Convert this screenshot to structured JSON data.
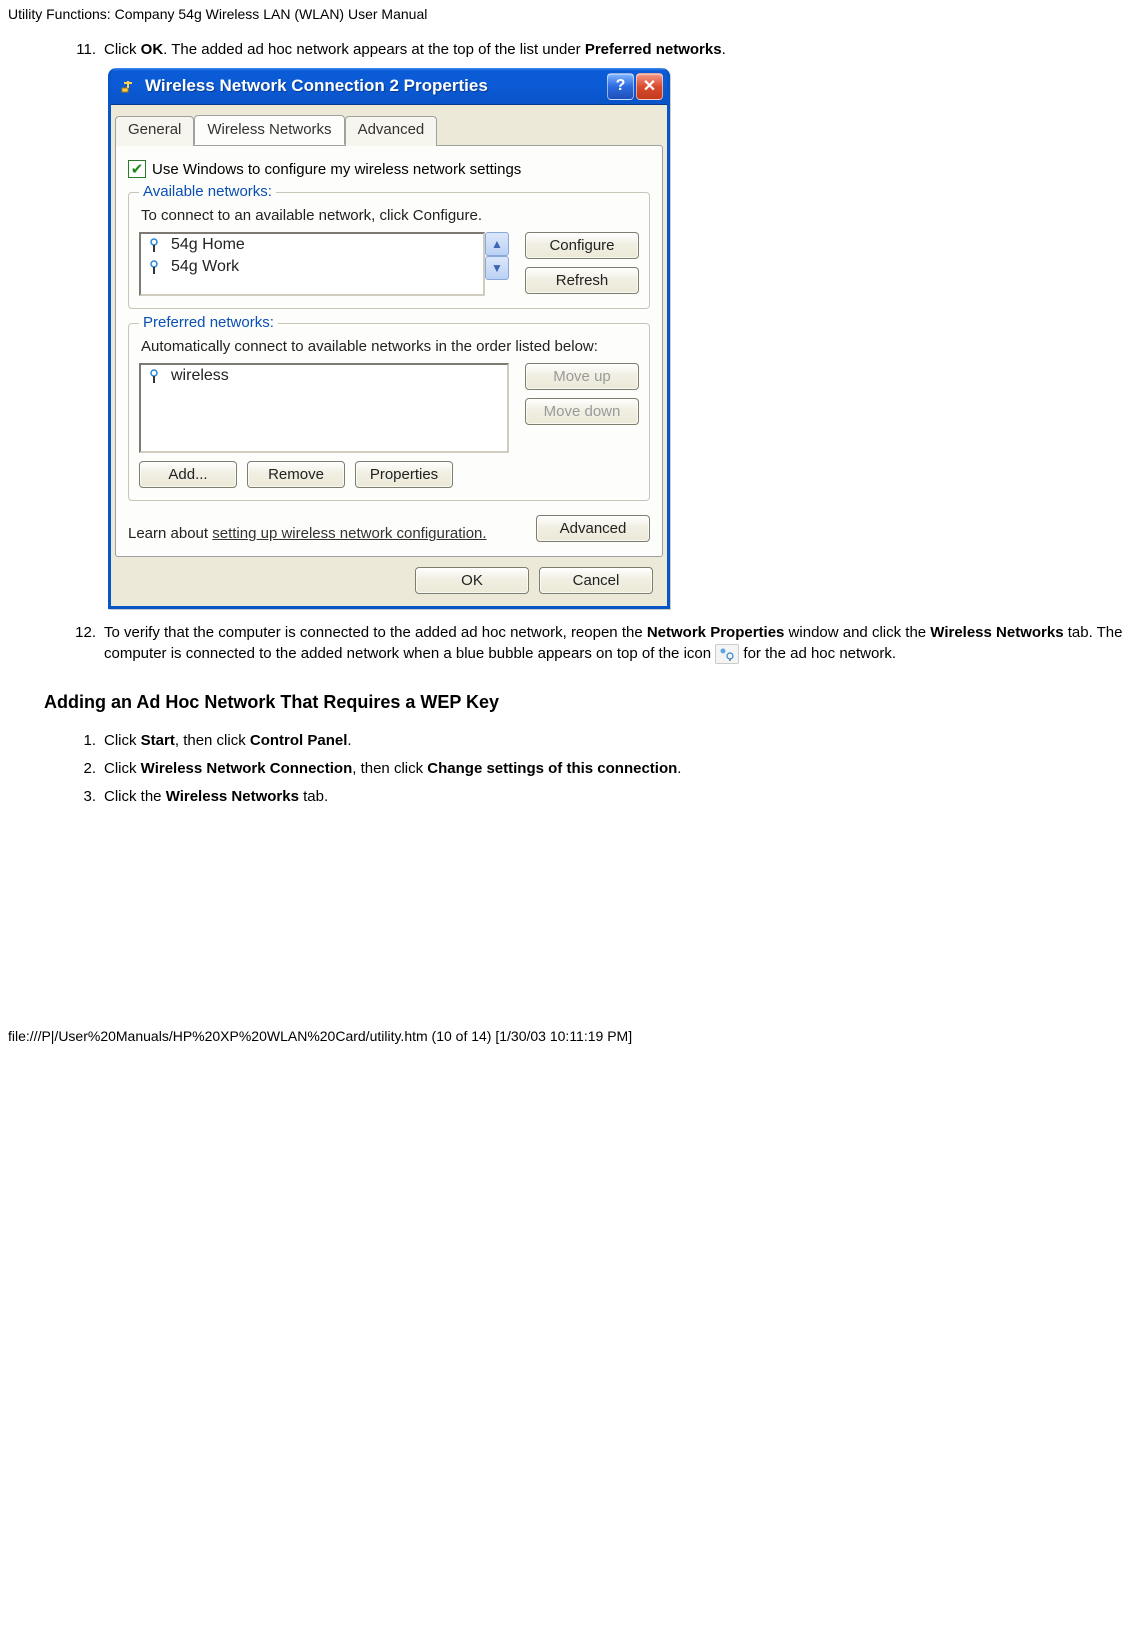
{
  "page_header": "Utility Functions: Company 54g Wireless LAN (WLAN) User Manual",
  "steps_a": {
    "11": {
      "pre": "Click ",
      "b1": "OK",
      "post1": ". The added ad hoc network appears at the top of the list under ",
      "b2": "Preferred networks",
      "post2": "."
    },
    "12": {
      "pre": "To verify that the computer is connected to the added ad hoc network, reopen the ",
      "b1": "Network Properties",
      "mid1": " window and click the ",
      "b2": "Wireless Networks",
      "mid2": " tab. The computer is connected to the added network when a blue bubble appears on top of the icon ",
      "post": " for the ad hoc network."
    }
  },
  "section_title": "Adding an Ad Hoc Network That Requires a WEP Key",
  "steps_b": {
    "1": {
      "pre": "Click ",
      "b1": "Start",
      "mid": ", then click ",
      "b2": "Control Panel",
      "post": "."
    },
    "2": {
      "pre": "Click ",
      "b1": "Wireless Network Connection",
      "mid": ", then click ",
      "b2": "Change settings of this connection",
      "post": "."
    },
    "3": {
      "pre": "Click the ",
      "b1": "Wireless Networks",
      "post": " tab."
    }
  },
  "dialog": {
    "title": "Wireless Network Connection 2 Properties",
    "tabs": {
      "general": "General",
      "wireless": "Wireless Networks",
      "advanced": "Advanced"
    },
    "use_windows": "Use Windows to configure my wireless network settings",
    "available": {
      "title": "Available networks:",
      "desc": "To connect to an available network, click Configure.",
      "items": [
        "54g Home",
        "54g Work"
      ],
      "configure": "Configure",
      "refresh": "Refresh"
    },
    "preferred": {
      "title": "Preferred networks:",
      "desc": "Automatically connect to available networks in the order listed below:",
      "items": [
        "wireless"
      ],
      "move_up": "Move up",
      "move_down": "Move down",
      "add": "Add...",
      "remove": "Remove",
      "properties": "Properties"
    },
    "learn_pre": "Learn about ",
    "learn_link": "setting up wireless network configuration.",
    "advanced_btn": "Advanced",
    "ok": "OK",
    "cancel": "Cancel"
  },
  "footer": "file:///P|/User%20Manuals/HP%20XP%20WLAN%20Card/utility.htm (10 of 14) [1/30/03 10:11:19 PM]"
}
